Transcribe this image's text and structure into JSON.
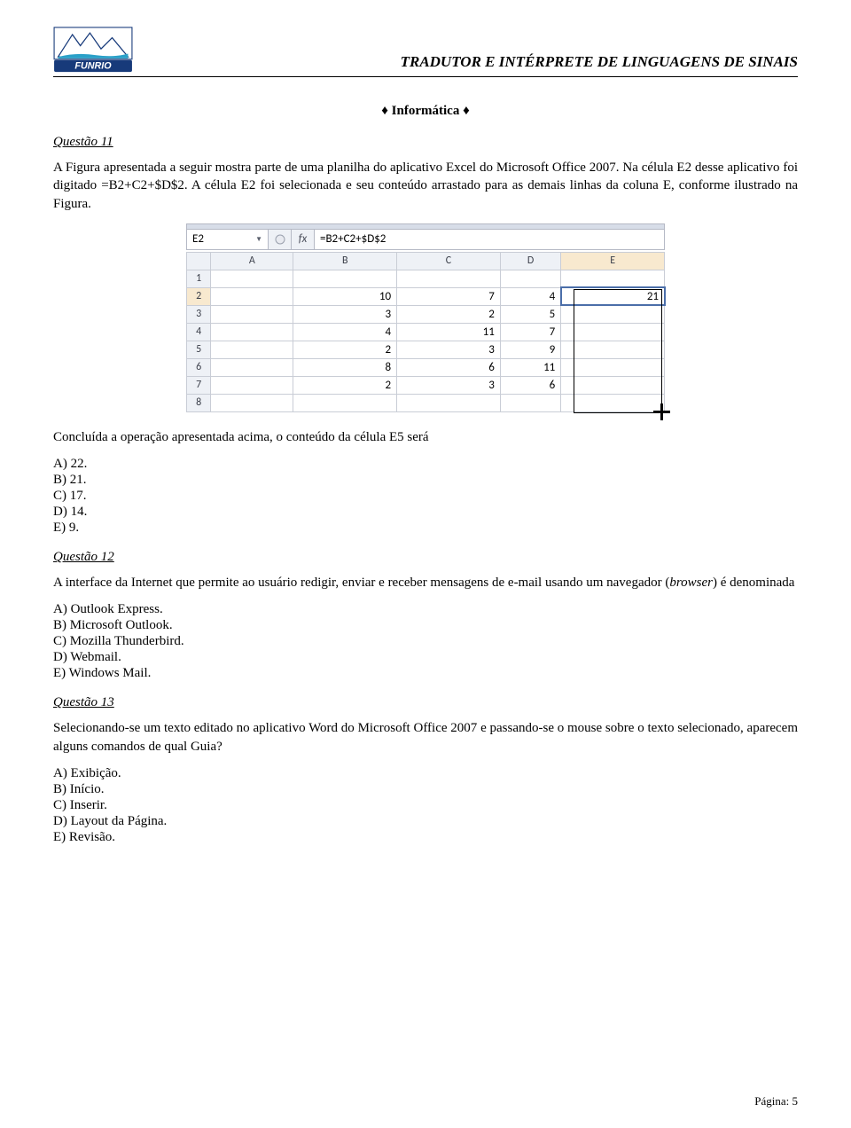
{
  "header": {
    "logo_text": "FUNRIO",
    "title": "TRADUTOR E INTÉRPRETE DE LINGUAGENS DE SINAIS"
  },
  "section_title": "♦ Informática ♦",
  "q11": {
    "label": "Questão 11",
    "p1": "A Figura apresentada a seguir mostra parte de uma planilha do aplicativo Excel do Microsoft Office 2007. Na célula E2 desse aplicativo foi digitado  =B2+C2+$D$2. A célula E2 foi selecionada e seu conteúdo arrastado para as demais linhas da coluna E, conforme ilustrado na Figura.",
    "p2": "Concluída a operação apresentada acima, o conteúdo da célula E5 será",
    "options": [
      "A)  22.",
      "B)  21.",
      "C)  17.",
      "D)  14.",
      "E)  9."
    ]
  },
  "excel": {
    "name_box": "E2",
    "fx": "fx",
    "formula": "=B2+C2+$D$2",
    "cols": [
      "A",
      "B",
      "C",
      "D",
      "E"
    ],
    "rows": [
      {
        "n": "1",
        "b": "",
        "c": "",
        "d": "",
        "e": ""
      },
      {
        "n": "2",
        "b": "10",
        "c": "7",
        "d": "4",
        "e": "21"
      },
      {
        "n": "3",
        "b": "3",
        "c": "2",
        "d": "5",
        "e": ""
      },
      {
        "n": "4",
        "b": "4",
        "c": "11",
        "d": "7",
        "e": ""
      },
      {
        "n": "5",
        "b": "2",
        "c": "3",
        "d": "9",
        "e": ""
      },
      {
        "n": "6",
        "b": "8",
        "c": "6",
        "d": "11",
        "e": ""
      },
      {
        "n": "7",
        "b": "2",
        "c": "3",
        "d": "6",
        "e": ""
      },
      {
        "n": "8",
        "b": "",
        "c": "",
        "d": "",
        "e": ""
      }
    ]
  },
  "q12": {
    "label": "Questão 12",
    "p1_a": "A interface da Internet que permite ao usuário redigir, enviar e receber mensagens de e-mail usando um navegador (",
    "p1_i": "browser",
    "p1_b": ") é denominada",
    "options": [
      "A)  Outlook Express.",
      "B)  Microsoft Outlook.",
      "C)  Mozilla Thunderbird.",
      "D)  Webmail.",
      "E)  Windows Mail."
    ]
  },
  "q13": {
    "label": "Questão 13",
    "p1": "Selecionando-se um texto editado no aplicativo Word do Microsoft Office 2007 e passando-se o mouse sobre o texto selecionado, aparecem alguns comandos de qual Guia?",
    "options": [
      "A)  Exibição.",
      "B)  Início.",
      "C)  Inserir.",
      "D)  Layout da Página.",
      "E)  Revisão."
    ]
  },
  "footer": "Página: 5"
}
